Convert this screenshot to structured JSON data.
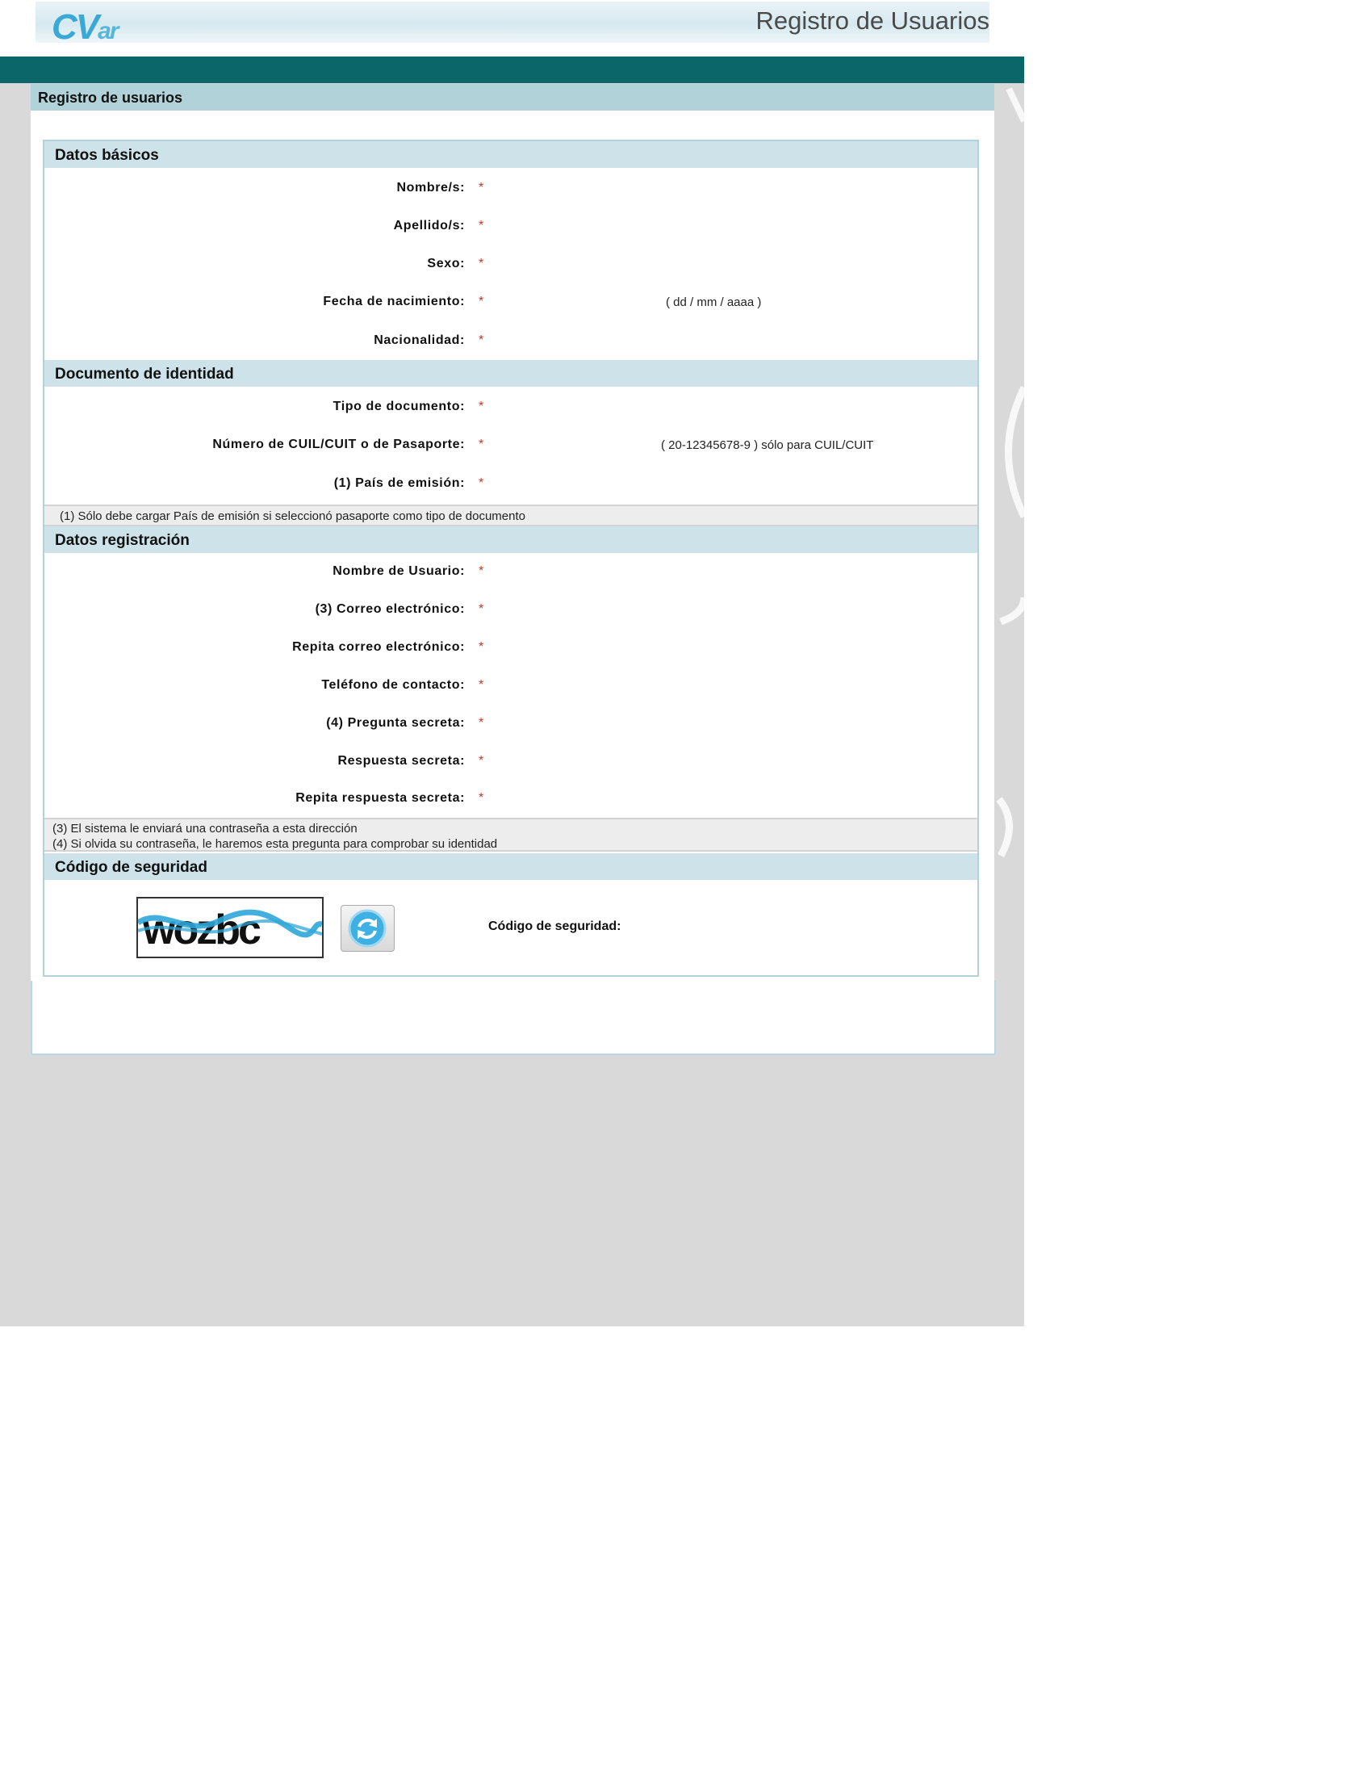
{
  "header": {
    "logo_main": "CV",
    "logo_suffix": "ar",
    "title": "Registro de Usuarios"
  },
  "main": {
    "title": "Registro de usuarios"
  },
  "sections": {
    "basic": {
      "title": "Datos básicos",
      "fields": {
        "nombres": "Nombre/s:",
        "apellidos": "Apellido/s:",
        "sexo": "Sexo:",
        "fecha_nacimiento": "Fecha de nacimiento:",
        "nacionalidad": "Nacionalidad:"
      },
      "date_hint": "( dd / mm / aaaa )"
    },
    "document": {
      "title": "Documento de identidad",
      "fields": {
        "tipo_documento": "Tipo de documento:",
        "numero": "Número de CUIL/CUIT o de Pasaporte:",
        "pais_emision": "(1) País de emisión:"
      },
      "number_hint": "( 20-12345678-9 ) sólo para CUIL/CUIT",
      "note": "(1) Sólo debe cargar País de emisión si seleccionó pasaporte como tipo de documento"
    },
    "registration": {
      "title": "Datos registración",
      "fields": {
        "usuario": "Nombre de Usuario:",
        "correo": "(3) Correo electrónico:",
        "repita_correo": "Repita correo electrónico:",
        "telefono": "Teléfono de contacto:",
        "pregunta": "(4) Pregunta secreta:",
        "respuesta": "Respuesta secreta:",
        "repita_respuesta": "Repita respuesta secreta:"
      },
      "notes": [
        "(3) El sistema le enviará una contraseña a esta dirección",
        "(4) Si olvida su contraseña, le haremos esta pregunta para comprobar su identidad"
      ]
    },
    "security": {
      "title": "Código de seguridad",
      "captcha_text": "wozbc",
      "label": "Código de seguridad:"
    }
  },
  "required_marker": "*",
  "icons": {
    "refresh": "refresh-icon"
  },
  "colors": {
    "teal_bar": "#0a6669",
    "section_header": "#cde3e9",
    "main_header": "#b2d2da",
    "required": "#c0392b",
    "logo": "#3ba8d6"
  }
}
